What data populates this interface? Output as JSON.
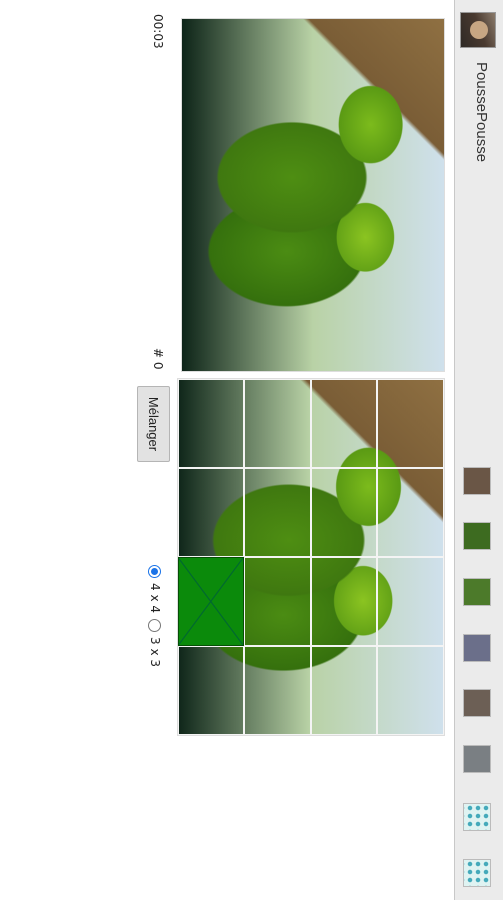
{
  "app": {
    "title": "PoussePousse",
    "icon": "app-logo-icon"
  },
  "toolbar": {
    "images": [
      {
        "name": "thumb-1",
        "icon": "image-thumbnail-icon"
      },
      {
        "name": "thumb-2",
        "icon": "image-thumbnail-icon"
      },
      {
        "name": "thumb-3",
        "icon": "image-thumbnail-icon"
      },
      {
        "name": "thumb-4",
        "icon": "image-thumbnail-icon"
      },
      {
        "name": "thumb-5",
        "icon": "image-thumbnail-icon"
      },
      {
        "name": "thumb-6",
        "icon": "image-thumbnail-icon"
      },
      {
        "name": "thumb-7",
        "icon": "pattern-thumbnail-icon"
      },
      {
        "name": "thumb-8",
        "icon": "pattern-thumbnail-icon"
      }
    ]
  },
  "game": {
    "timer": "00:03",
    "moves": "# 0",
    "shuffle_label": "Mélanger",
    "size_options": [
      {
        "label": "4 x 4",
        "selected": true
      },
      {
        "label": "3 x 3",
        "selected": false
      }
    ],
    "grid_size": 4,
    "empty_tile": {
      "row": 3,
      "col": 2
    },
    "colors": {
      "empty_tile": "#0b8a0b",
      "accent": "#1a73e8",
      "toolbar_bg": "#ebebeb"
    }
  }
}
